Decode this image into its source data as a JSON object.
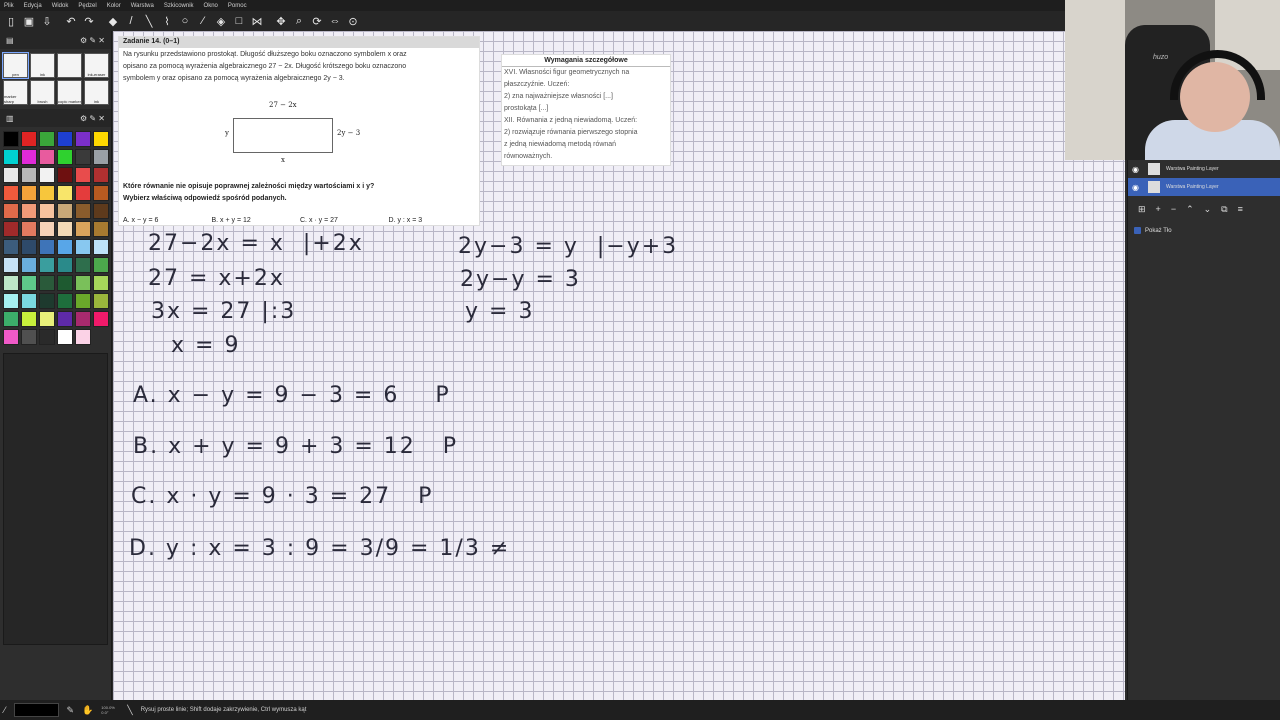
{
  "menu": [
    "Plik",
    "Edycja",
    "Widok",
    "Pędzel",
    "Kolor",
    "Warstwa",
    "Szkicownik",
    "Okno",
    "Pomoc"
  ],
  "toolbar_icons": [
    "new-file-icon",
    "save-icon",
    "export-icon",
    "undo-icon",
    "redo-icon",
    "eraser-icon",
    "pen-icon",
    "line-icon",
    "lasso-icon",
    "ellipse-icon",
    "eyedropper-icon",
    "fill-icon",
    "rect-icon",
    "symmetry-icon",
    "move-icon",
    "zoom-icon",
    "rotate-icon",
    "flip-icon",
    "reset-view-icon"
  ],
  "colors": [
    "#000000",
    "#e02424",
    "#3aa63a",
    "#1e3fd1",
    "#7b2fc9",
    "#ffd800",
    "#00d2d2",
    "#e02ad8",
    "#e85b9e",
    "#2fd12f",
    "#3a3a3a",
    "#9aa0a6",
    "#e8e8e8",
    "#b8b8b8",
    "#f2f2f2",
    "#6e1010",
    "#e84c4c",
    "#b03030",
    "#f05a3c",
    "#f3a23a",
    "#f7c63c",
    "#f8e56a",
    "#e43c3c",
    "#b85a20",
    "#e06a4a",
    "#f19a78",
    "#f6c29e",
    "#c9a878",
    "#8a5c2c",
    "#5e3a1c",
    "#a02a2a",
    "#e27a60",
    "#f6d2b8",
    "#f3d9b6",
    "#d9a35c",
    "#a87a30",
    "#3c5c7c",
    "#2e4a6a",
    "#3e74b8",
    "#58a6e8",
    "#88c8f0",
    "#bde2f8",
    "#c7e2f6",
    "#6aaedc",
    "#3a9e9e",
    "#2a8a8a",
    "#2e6e4c",
    "#4ca84c",
    "#bde6c8",
    "#5ec88a",
    "#2a5a3a",
    "#1e5a30",
    "#7ac05a",
    "#a6d65a",
    "#a6f0f0",
    "#7ad8e0",
    "#1e3a2e",
    "#1e6e3c",
    "#6aa82a",
    "#9ab63c",
    "#3cae6a",
    "#c8f03c",
    "#e8f07a",
    "#5e2aa8",
    "#a82a6e",
    "#f01a6a",
    "#f05ac8",
    "#505050",
    "#2a2a2a",
    "#ffffff",
    "#fbd2e6"
  ],
  "left_panel": {
    "brush_labels": [
      "pen",
      "ink",
      "",
      "ink-eraser",
      "marker sharp",
      "brush",
      "copic marker",
      "ink"
    ]
  },
  "task": {
    "title": "Zadanie 14. (0–1)",
    "text1": "Na rysunku przedstawiono prostokąt. Długość dłuższego boku oznaczono symbolem  x  oraz",
    "text2": "opisano za pomocą wyrażenia algebraicznego  27 − 2x. Długość krótszego boku oznaczono",
    "text3": "symbolem  y  oraz opisano za pomocą wyrażenia algebraicznego  2y − 3.",
    "label_top": "27 − 2x",
    "label_left": "y",
    "label_right": "2y − 3",
    "label_bottom": "x",
    "question1": "Które równanie nie opisuje poprawnej zależności między wartościami  x  i  y?",
    "question2": "Wybierz właściwą odpowiedź spośród podanych.",
    "optA": "A.  x − y = 6",
    "optB": "B.  x + y = 12",
    "optC": "C.  x · y = 27",
    "optD": "D.  y : x = 3"
  },
  "req": {
    "title": "Wymagania szczegółowe",
    "lines": [
      "XVI. Własności figur geometrycznych na",
      "płaszczyźnie. Uczeń:",
      "2) zna najważniejsze własności [...]",
      "prostokąta [...]",
      "XII. Równania z jedną niewiadomą. Uczeń:",
      "2) rozwiązuje równania pierwszego stopnia",
      "z jedną niewiadomą metodą równań",
      "równoważnych."
    ]
  },
  "handwriting": {
    "l1": "27−2x = x  |+2x",
    "l2": "27 = x+2x",
    "l3": "3x = 27 |:3",
    "l4": "x = 9",
    "r1": "2y−3 = y  |−y+3",
    "r2": "2y−y = 3",
    "r3": "y = 3",
    "a": "A. x − y = 9 − 3 = 6    P",
    "b": "B. x + y = 9 + 3 = 12   P",
    "c": "C. x · y = 9 · 3 = 27   P",
    "d": "D. y : x = 3 : 9 = 3/9 = 1/3 ≠"
  },
  "layers": [
    {
      "name": "Warstwa\nPainting Layer",
      "active": false
    },
    {
      "name": "Warstwa\nPainting Layer",
      "active": true
    }
  ],
  "reference_label": "Pokaż Tło",
  "webcam": {
    "chair_logo": "huzo"
  },
  "status": {
    "zoom": "100.0%",
    "angle": "0.0°",
    "hint": "Rysuj proste linie; Shift dodaje zakrzywienie, Ctrl wymusza kąt"
  }
}
